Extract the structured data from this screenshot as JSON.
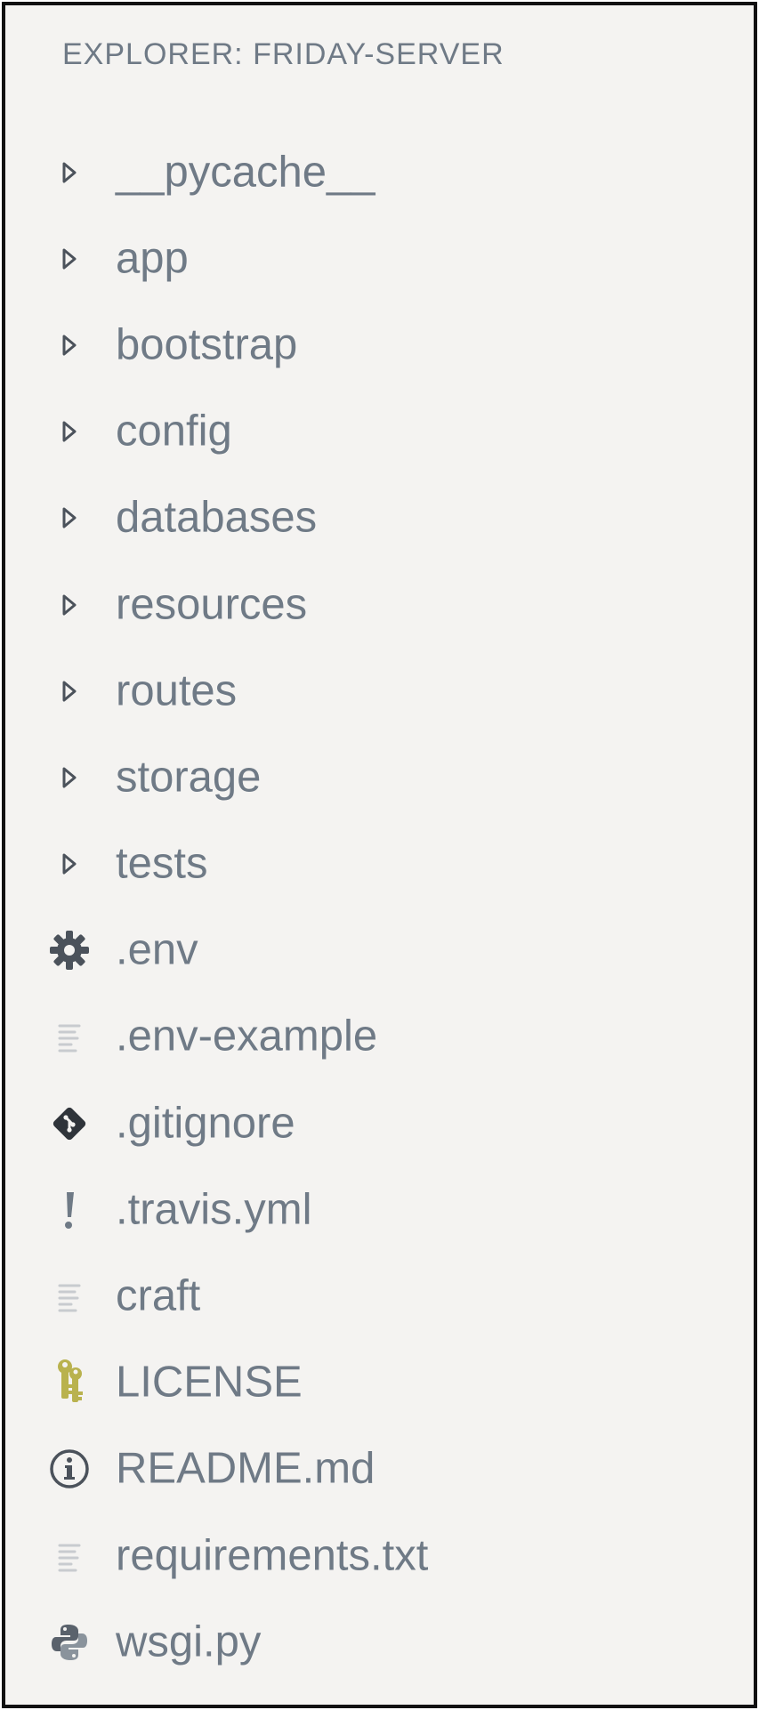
{
  "explorer": {
    "title": "EXPLORER: FRIDAY-SERVER",
    "folders": [
      {
        "label": "__pycache__",
        "icon": "chevron-right-icon"
      },
      {
        "label": "app",
        "icon": "chevron-right-icon"
      },
      {
        "label": "bootstrap",
        "icon": "chevron-right-icon"
      },
      {
        "label": "config",
        "icon": "chevron-right-icon"
      },
      {
        "label": "databases",
        "icon": "chevron-right-icon"
      },
      {
        "label": "resources",
        "icon": "chevron-right-icon"
      },
      {
        "label": "routes",
        "icon": "chevron-right-icon"
      },
      {
        "label": "storage",
        "icon": "chevron-right-icon"
      },
      {
        "label": "tests",
        "icon": "chevron-right-icon"
      }
    ],
    "files": [
      {
        "label": ".env",
        "icon": "gear-icon"
      },
      {
        "label": ".env-example",
        "icon": "text-file-icon"
      },
      {
        "label": ".gitignore",
        "icon": "git-icon"
      },
      {
        "label": ".travis.yml",
        "icon": "exclamation-icon"
      },
      {
        "label": "craft",
        "icon": "text-file-icon"
      },
      {
        "label": "LICENSE",
        "icon": "keys-icon"
      },
      {
        "label": "README.md",
        "icon": "info-icon"
      },
      {
        "label": "requirements.txt",
        "icon": "text-file-icon"
      },
      {
        "label": "wsgi.py",
        "icon": "python-icon"
      }
    ]
  },
  "colors": {
    "background": "#f4f3f1",
    "text": "#6f7a86",
    "icon_dark": "#4b525b",
    "icon_light": "#c8cbcf",
    "license_icon": "#b9b24e",
    "border": "#111111"
  }
}
